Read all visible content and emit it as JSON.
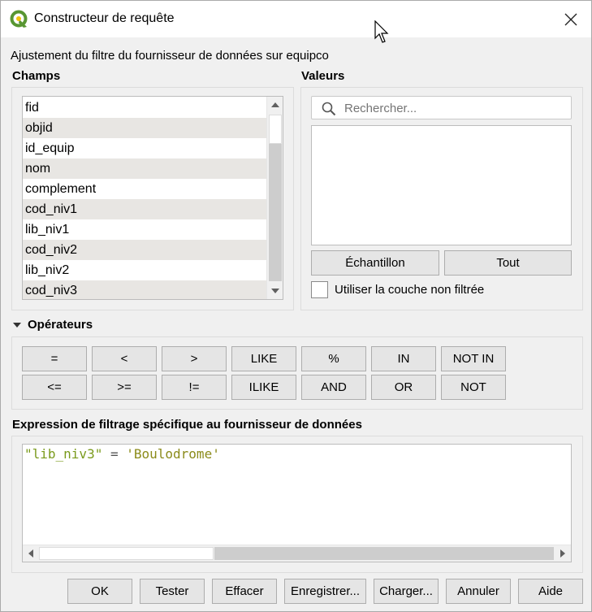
{
  "window": {
    "title": "Constructeur de requête",
    "subtitle": "Ajustement du filtre du fournisseur de données sur equipco"
  },
  "fields": {
    "label": "Champs",
    "items": [
      "fid",
      "objid",
      "id_equip",
      "nom",
      "complement",
      "cod_niv1",
      "lib_niv1",
      "cod_niv2",
      "lib_niv2",
      "cod_niv3"
    ]
  },
  "values": {
    "label": "Valeurs",
    "search_placeholder": "Rechercher...",
    "sample_button": "Échantillon",
    "all_button": "Tout",
    "unfiltered_checkbox_label": "Utiliser la couche non filtrée",
    "unfiltered_checked": false
  },
  "operators": {
    "label": "Opérateurs",
    "row1": [
      "=",
      "<",
      ">",
      "LIKE",
      "%",
      "IN",
      "NOT IN"
    ],
    "row2": [
      "<=",
      ">=",
      "!=",
      "ILIKE",
      "AND",
      "OR",
      "NOT"
    ]
  },
  "expression": {
    "label": "Expression de filtrage spécifique au fournisseur de données",
    "field_token": "\"lib_niv3\"",
    "operator_token": " = ",
    "string_token": "'Boulodrome'"
  },
  "footer": {
    "ok": "OK",
    "test": "Tester",
    "clear": "Effacer",
    "save": "Enregistrer...",
    "load": "Charger...",
    "cancel": "Annuler",
    "help": "Aide"
  },
  "icons": {
    "app": "qgis-logo-icon",
    "close": "close-icon",
    "search": "search-icon",
    "collapse": "triangle-down-icon",
    "cursor": "mouse-pointer-icon"
  },
  "colors": {
    "qgis_green": "#589632",
    "qgis_yellow": "#f0c20c",
    "expr_field": "#7a9a1c",
    "expr_string": "#8b8b1a"
  }
}
